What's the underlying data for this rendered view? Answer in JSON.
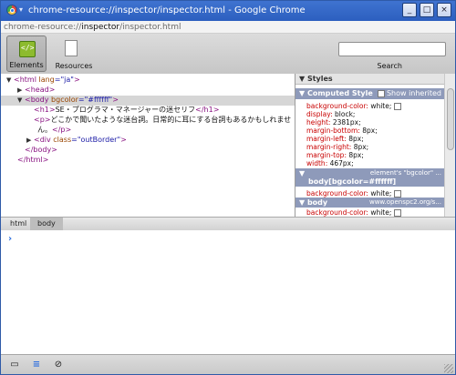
{
  "window": {
    "title": "chrome-resource://inspector/inspector.html - Google Chrome",
    "buttons": {
      "minimize": "_",
      "maximize": "□",
      "close": "×"
    }
  },
  "address": {
    "prefix": "chrome-resource://",
    "host": "inspector",
    "path": "/inspector.html"
  },
  "toolbar": {
    "elements_label": "Elements",
    "resources_label": "Resources",
    "search_label": "Search",
    "search_value": ""
  },
  "dom": {
    "lines": [
      {
        "parts": [
          {
            "t": "<html ",
            "c": "tag"
          },
          {
            "t": "lang",
            "c": "attr"
          },
          {
            "t": "=\"ja\"",
            "c": "val"
          },
          {
            "t": ">",
            "c": "tag"
          }
        ]
      },
      {
        "parts": [
          {
            "t": "<head>",
            "c": "tag"
          }
        ]
      },
      {
        "parts": [
          {
            "t": "<body ",
            "c": "tag"
          },
          {
            "t": "bgcolor",
            "c": "attr"
          },
          {
            "t": "=\"#ffffff\"",
            "c": "val"
          },
          {
            "t": ">",
            "c": "tag"
          }
        ]
      },
      {
        "parts": [
          {
            "t": "<h1>",
            "c": "tag"
          },
          {
            "t": "SE・プログラマ・マネージャーの迷セリフ",
            "c": "txt"
          },
          {
            "t": "</h1>",
            "c": "tag"
          }
        ]
      },
      {
        "parts": [
          {
            "t": "<p>",
            "c": "tag"
          },
          {
            "t": "どこかで聞いたような迷台詞。日常的に耳にする台詞もあるかもしれませ",
            "c": "txt"
          }
        ]
      },
      {
        "parts": [
          {
            "t": "ん。",
            "c": "txt"
          },
          {
            "t": "</p>",
            "c": "tag"
          }
        ]
      },
      {
        "parts": [
          {
            "t": "<div ",
            "c": "tag"
          },
          {
            "t": "class",
            "c": "attr"
          },
          {
            "t": "=\"outBorder\"",
            "c": "val"
          },
          {
            "t": ">",
            "c": "tag"
          }
        ]
      },
      {
        "parts": [
          {
            "t": "</body>",
            "c": "tag"
          }
        ]
      },
      {
        "parts": [
          {
            "t": "</html>",
            "c": "tag"
          }
        ]
      }
    ]
  },
  "styles": {
    "header": "Styles",
    "computed": {
      "title": "Computed Style",
      "show_inherited_label": "Show inherited",
      "props": [
        [
          "background-color",
          "white;"
        ],
        [
          "display",
          "block;"
        ],
        [
          "height",
          "2381px;"
        ],
        [
          "margin-bottom",
          "8px;"
        ],
        [
          "margin-left",
          "8px;"
        ],
        [
          "margin-right",
          "8px;"
        ],
        [
          "margin-top",
          "8px;"
        ],
        [
          "width",
          "467px;"
        ]
      ]
    },
    "rule1": {
      "source": "element's \"bgcolor\" ...",
      "selector": "body[bgcolor=#ffffff]",
      "props": [
        [
          "background-color",
          "white;"
        ]
      ]
    },
    "rule2": {
      "selector": "body",
      "source": "www.openspc2.org/s...",
      "props": [
        [
          "background-color",
          "white;"
        ]
      ]
    }
  },
  "breadcrumb": {
    "items": [
      "html",
      "body"
    ]
  },
  "console": {
    "prompt": "›"
  },
  "statusbar": {
    "dock": "▭",
    "console": "≡",
    "clear": "⊘"
  }
}
